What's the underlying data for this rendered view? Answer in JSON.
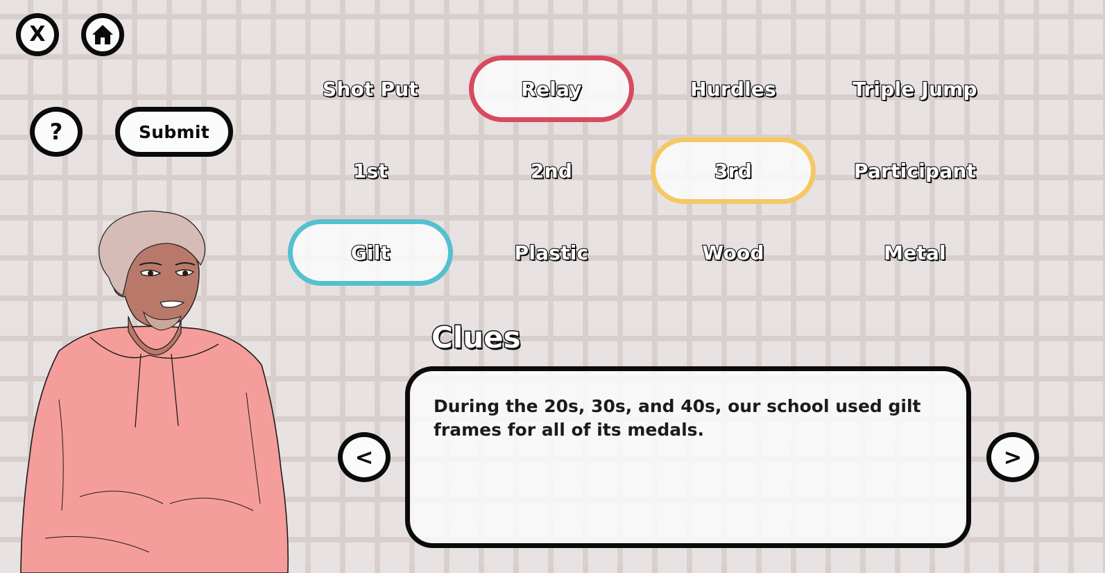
{
  "controls": {
    "close_label": "X",
    "home_icon": "home-icon",
    "help_label": "?",
    "submit_label": "Submit"
  },
  "rows": [
    {
      "options": [
        {
          "label": "Shot Put",
          "selected": false
        },
        {
          "label": "Relay",
          "selected": true,
          "color": "#d84a5f"
        },
        {
          "label": "Hurdles",
          "selected": false
        },
        {
          "label": "Triple Jump",
          "selected": false
        }
      ]
    },
    {
      "options": [
        {
          "label": "1st",
          "selected": false
        },
        {
          "label": "2nd",
          "selected": false
        },
        {
          "label": "3rd",
          "selected": true,
          "color": "#f4c865"
        },
        {
          "label": "Participant",
          "selected": false
        }
      ]
    },
    {
      "options": [
        {
          "label": "Gilt",
          "selected": true,
          "color": "#55c0cf"
        },
        {
          "label": "Plastic",
          "selected": false
        },
        {
          "label": "Wood",
          "selected": false
        },
        {
          "label": "Metal",
          "selected": false
        }
      ]
    }
  ],
  "clues": {
    "title": "Clues",
    "text": "During the 20s, 30s, and 40s, our school used gilt frames for all of its medals.",
    "prev_label": "<",
    "next_label": ">"
  },
  "colors": {
    "background": "#e7e2e1",
    "mortar": "#d8cfcd",
    "outline": "#0b0b0b",
    "hoodie": "#f59d9a",
    "skin": "#b9796a",
    "hair": "#d6bcb6"
  }
}
